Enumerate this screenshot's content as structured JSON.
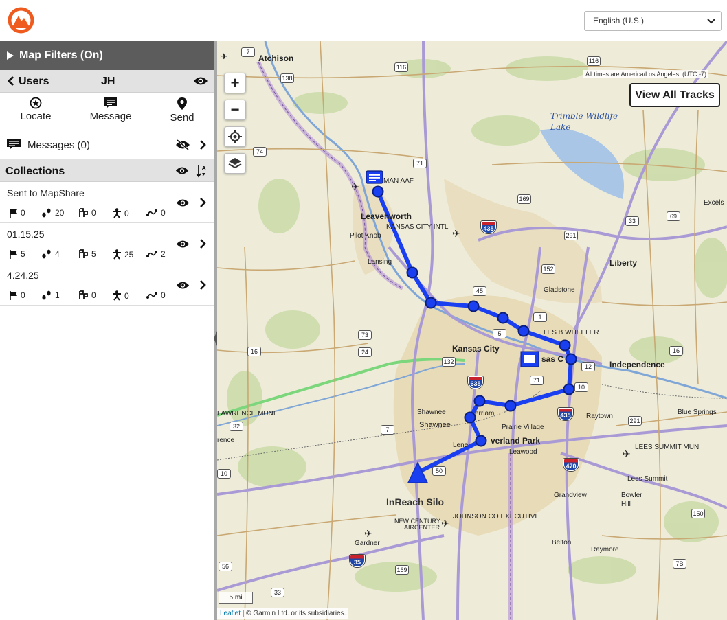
{
  "header": {
    "language": "English (U.S.)"
  },
  "sidebar": {
    "filters_label": "Map Filters (On)",
    "users_label": "Users",
    "user_initials": "JH",
    "actions": [
      {
        "label": "Locate",
        "icon": "locate-icon"
      },
      {
        "label": "Message",
        "icon": "message-icon"
      },
      {
        "label": "Send",
        "icon": "send-pin-icon"
      }
    ],
    "messages_label": "Messages (0)",
    "collections_label": "Collections",
    "collections": [
      {
        "name": "Sent to MapShare",
        "flags": "0",
        "tracks": "20",
        "waypoints": "0",
        "people": "0",
        "routes": "0"
      },
      {
        "name": "01.15.25",
        "flags": "5",
        "tracks": "4",
        "waypoints": "5",
        "people": "25",
        "routes": "2"
      },
      {
        "name": "4.24.25",
        "flags": "0",
        "tracks": "1",
        "waypoints": "0",
        "people": "0",
        "routes": "0"
      }
    ]
  },
  "map": {
    "timezone_note": "All times are America/Los Angeles. (UTC -7)",
    "view_all_tracks": "View All Tracks",
    "zoom_in": "+",
    "zoom_out": "−",
    "scale": "5 mi",
    "attribution_link": "Leaflet",
    "attribution_text": " | © Garmin Ltd. or its subsidiaries.",
    "device_label": "InReach Silo",
    "track_color": "#1a3ff0",
    "labels": {
      "atchison": "Atchison",
      "leavenworth": "Leavenworth",
      "pilot_knob": "Pilot Knob",
      "lansing": "Lansing",
      "kc_intl": "KANSAS CITY INTL",
      "man_aaf": "MAN AAF",
      "trimble1": "Trimble Wildlife",
      "trimble2": "Lake",
      "liberty": "Liberty",
      "excels": "Excels",
      "gladstone": "Gladstone",
      "wheeler": "LES B WHEELER",
      "kansas_city": "Kansas City",
      "sas_c": "sas C",
      "independence": "Independence",
      "lawrence_muni": "LAWRENCE MUNI",
      "shawnee1": "Shawnee",
      "shawnee2": "Shawnee",
      "merriam": "erriam",
      "prairie_village": "Prairie Village",
      "overland_park": "verland Park",
      "lenexa": "Lene",
      "leawood": "Leawood",
      "raytown": "Raytown",
      "blue_springs": "Blue Springs",
      "lees_summit_muni": "LEES SUMMIT MUNI",
      "lees_summit": "Lees Summit",
      "bowler": "Bowler",
      "hill": "Hill",
      "grandview": "Grandview",
      "johnson_co": "JOHNSON CO EXECUTIVE",
      "new_century1": "NEW CENTURY",
      "new_century2": "AIRCENTER",
      "gardner": "Gardner",
      "belton": "Belton",
      "raymore": "Raymore",
      "rence": "rence"
    },
    "shields": {
      "s7": "7",
      "s116a": "116",
      "s116b": "116",
      "s138": "138",
      "s74": "74",
      "s71": "71",
      "s169a": "169",
      "s33": "33",
      "s69": "69",
      "s291a": "291",
      "s152": "152",
      "s45": "45",
      "s1": "1",
      "s5": "5",
      "s73": "73",
      "s24": "24",
      "s16": "16",
      "s132": "132",
      "s7b": "7",
      "s32": "32",
      "s10a": "10",
      "s10b": "10",
      "s12": "12",
      "s16b": "16",
      "s291b": "291",
      "s150": "150",
      "s50": "50",
      "s56": "56",
      "s169b": "169",
      "s33b": "33",
      "s7B": "7B",
      "s71b": "71"
    },
    "interstates": {
      "i35a": "35",
      "i435": "435",
      "i635": "635",
      "i435b": "435",
      "i470": "470",
      "i35b": "35"
    }
  }
}
